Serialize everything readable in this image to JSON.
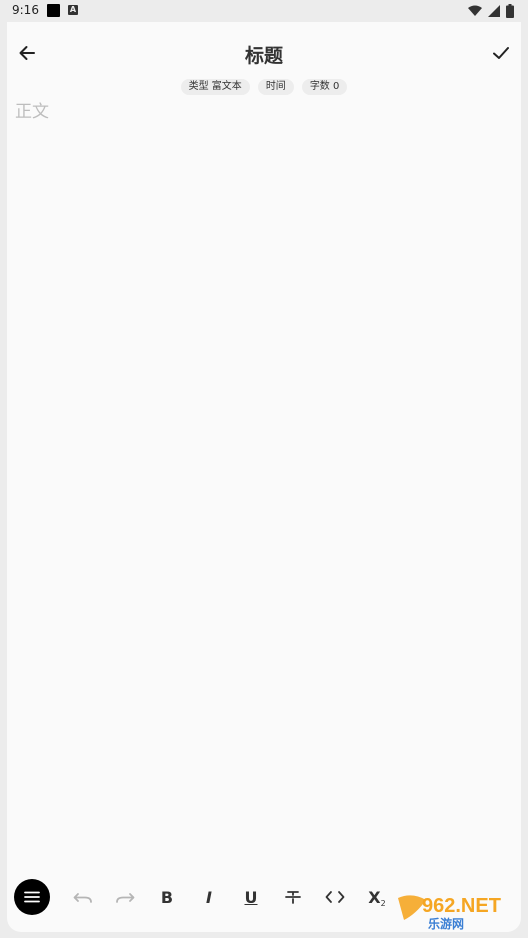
{
  "status_bar": {
    "time": "9:16"
  },
  "header": {
    "title": "标题"
  },
  "meta": {
    "type_chip": "类型 富文本",
    "time_chip": "时间",
    "count_chip": "字数 0"
  },
  "editor": {
    "body_placeholder": "正文",
    "body_value": ""
  },
  "toolbar": {
    "bold_label": "B",
    "italic_label": "I",
    "underline_label": "U",
    "subscript_label": "X",
    "subscript_sub": "2"
  },
  "watermark": {
    "logo_text": "962.NET",
    "site_text": "乐游网"
  },
  "colors": {
    "background": "#fafafa",
    "chip": "#ededed",
    "text": "#333333",
    "disabled": "#b5b5b5",
    "menu_button": "#000000"
  }
}
